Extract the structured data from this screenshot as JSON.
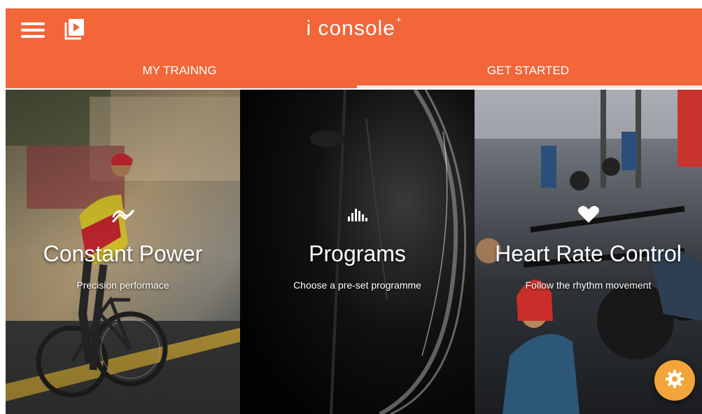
{
  "header": {
    "title": "i console",
    "title_sup": "+",
    "menu_icon": "hamburger-menu-icon",
    "video_icon": "video-library-icon"
  },
  "tabs": [
    {
      "label": "MY TRAINNG",
      "active": false
    },
    {
      "label": "GET STARTED",
      "active": true
    }
  ],
  "panels": [
    {
      "title": "Constant Power",
      "subtitle": "Precision performace",
      "icon": "constant-power-icon"
    },
    {
      "title": "Programs",
      "subtitle": "Choose a pre-set programme",
      "icon": "bar-graph-icon"
    },
    {
      "title": "Heart Rate Control",
      "subtitle": "Follow the rhythm movement",
      "icon": "heart-icon"
    }
  ],
  "fab": {
    "icon": "gear-icon"
  },
  "colors": {
    "brand": "#f2663a",
    "fab": "#f3a43a"
  }
}
